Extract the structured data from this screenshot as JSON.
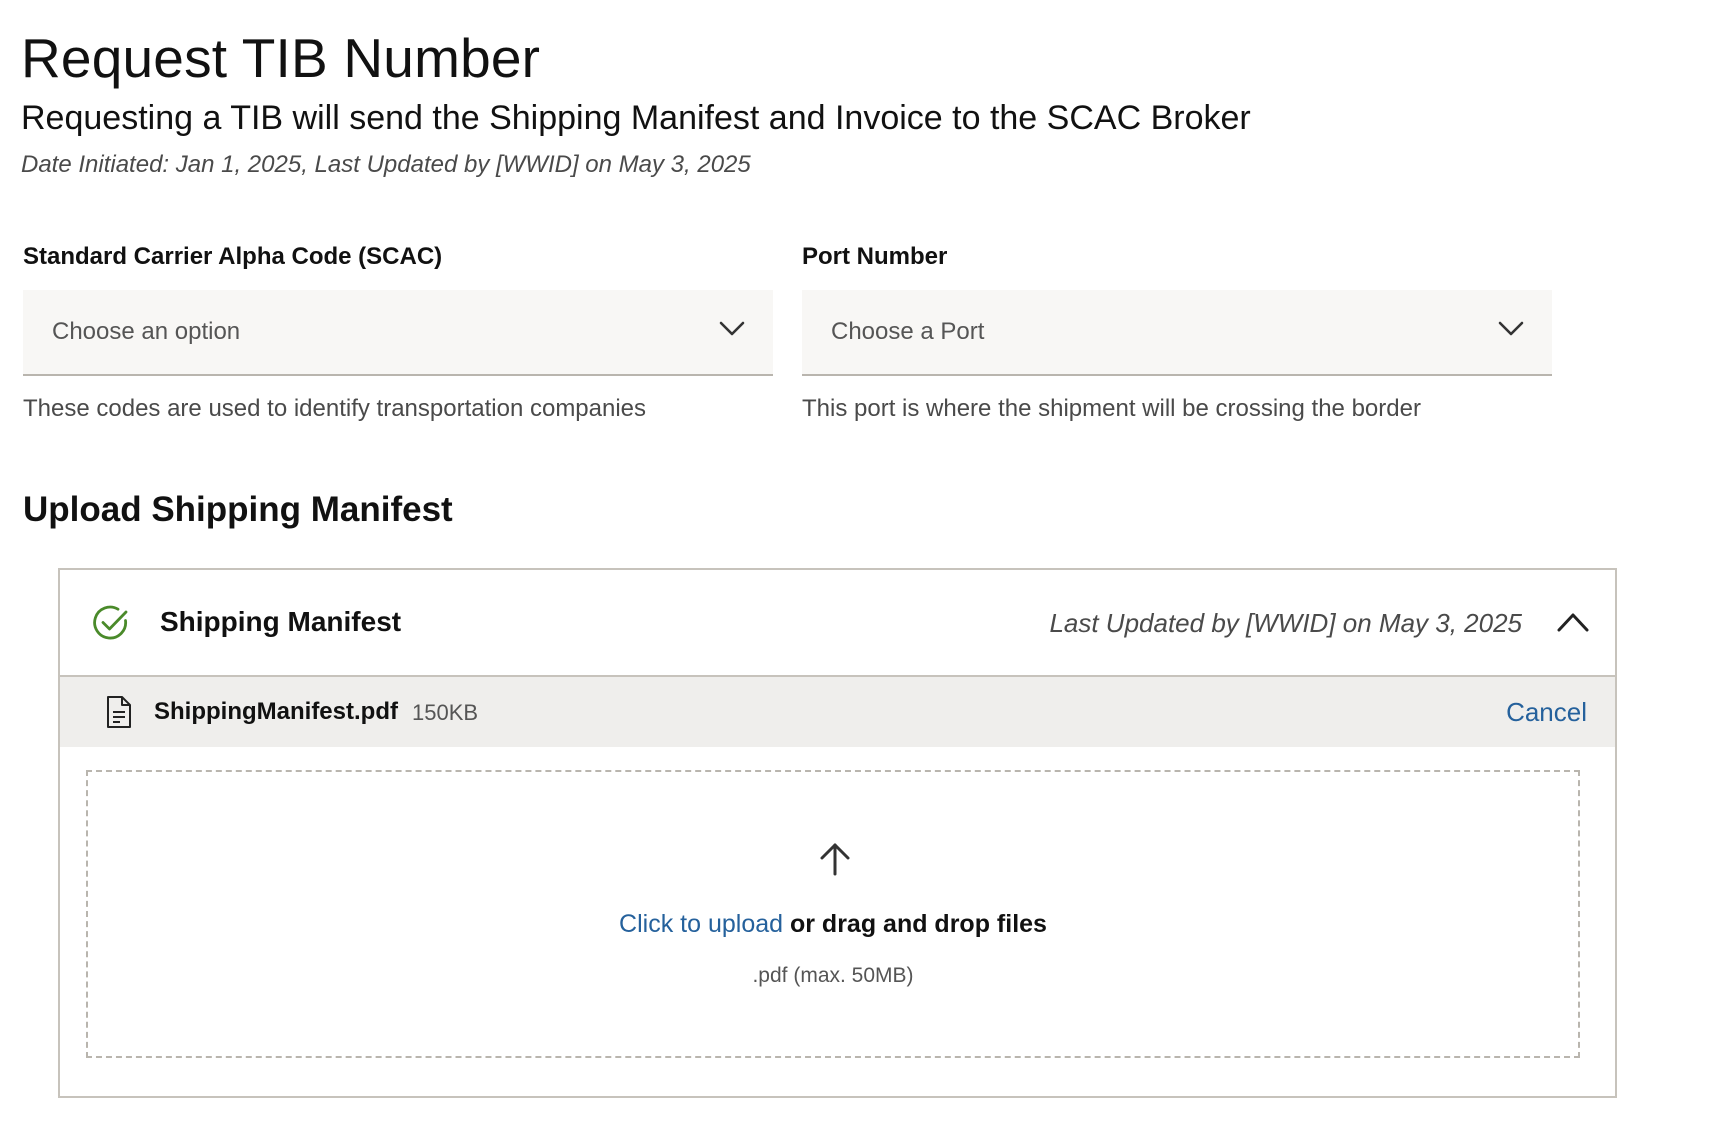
{
  "header": {
    "title": "Request TIB Number",
    "subtitle": "Requesting a TIB will send the Shipping Manifest and Invoice to the SCAC Broker",
    "meta": "Date Initiated: Jan 1, 2025, Last Updated by [WWID] on May 3, 2025"
  },
  "fields": {
    "scac": {
      "label": "Standard Carrier Alpha Code (SCAC)",
      "value": "Choose an option",
      "helper": "These codes are used to identify transportation companies"
    },
    "port": {
      "label": "Port Number",
      "value": "Choose a Port",
      "helper": "This port is where the shipment will be crossing the border"
    }
  },
  "upload_section": {
    "title": "Upload Shipping Manifest",
    "card": {
      "title": "Shipping Manifest",
      "updated": "Last Updated by [WWID] on May 3, 2025",
      "status_icon": "check-circle-icon",
      "file": {
        "name": "ShippingManifest.pdf",
        "size": "150KB",
        "cancel_label": "Cancel"
      },
      "dropzone": {
        "link_text": "Click to upload",
        "rest_text": " or drag and drop files",
        "hint": ".pdf (max. 50MB)"
      }
    }
  },
  "colors": {
    "accent_link": "#25619c",
    "success": "#4a8a2a",
    "field_bg": "#f8f7f5",
    "file_row_bg": "#efeeec",
    "border": "#c7c3bc"
  }
}
